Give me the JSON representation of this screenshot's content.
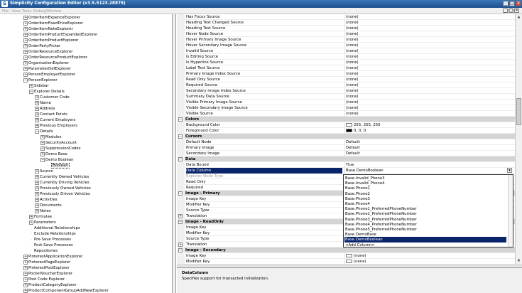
{
  "window": {
    "title": "Simplicity Configuration Editor (v3.5.5123.28879)",
    "icon_glyph": "S",
    "controls": {
      "minimize": "_",
      "maximize": "□",
      "close": "✕"
    }
  },
  "menu": {
    "items": [
      "File",
      "View",
      "Tools",
      "Debug",
      "Window"
    ],
    "mdi_controls": {
      "minimize": "_",
      "restore": "□",
      "close": "✕"
    }
  },
  "tree": {
    "rows": [
      {
        "label": "OrderItemExpenceExplorer",
        "depth": 3,
        "glyph": "+"
      },
      {
        "label": "OrderItemFixedPriceExplorer",
        "depth": 3,
        "glyph": "+"
      },
      {
        "label": "OrderItemNoteExplorer",
        "depth": 3,
        "glyph": "+"
      },
      {
        "label": "OrderItemProductExpandedExplorer",
        "depth": 3,
        "glyph": "+"
      },
      {
        "label": "OrderItemProductExplorer",
        "depth": 3,
        "glyph": "+"
      },
      {
        "label": "OrderPartyPicker",
        "depth": 3,
        "glyph": "+"
      },
      {
        "label": "OrderResourceExplorer",
        "depth": 3,
        "glyph": "+"
      },
      {
        "label": "OrderResourceProductExplorer",
        "depth": 3,
        "glyph": "+"
      },
      {
        "label": "OrganisationExplorer",
        "depth": 3,
        "glyph": "+"
      },
      {
        "label": "ParameterDefExplorer",
        "depth": 3,
        "glyph": "+"
      },
      {
        "label": "PersonEmployerExplorer",
        "depth": 3,
        "glyph": "+"
      },
      {
        "label": "PersonExplorer",
        "depth": 3,
        "glyph": "−"
      },
      {
        "label": "Sidebar",
        "depth": 4,
        "glyph": "+"
      },
      {
        "label": "Explorer Details",
        "depth": 4,
        "glyph": "−"
      },
      {
        "label": "Customer Code",
        "depth": 5,
        "glyph": "+"
      },
      {
        "label": "Name",
        "depth": 5,
        "glyph": "+"
      },
      {
        "label": "Address",
        "depth": 5,
        "glyph": "+"
      },
      {
        "label": "Contact Points",
        "depth": 5,
        "glyph": "+"
      },
      {
        "label": "Current Employers",
        "depth": 5,
        "glyph": "+"
      },
      {
        "label": "Previous Employers",
        "depth": 5,
        "glyph": "+"
      },
      {
        "label": "Details",
        "depth": 5,
        "glyph": "−"
      },
      {
        "label": "Modules",
        "depth": 6,
        "glyph": "+"
      },
      {
        "label": "SecurityAccount",
        "depth": 6,
        "glyph": "+"
      },
      {
        "label": "SuppressionCodes",
        "depth": 6,
        "glyph": "+"
      },
      {
        "label": "Demo Base",
        "depth": 6,
        "glyph": "+"
      },
      {
        "label": "Demo Boolean",
        "depth": 6,
        "glyph": "−"
      },
      {
        "label": "Boolean",
        "depth": 7,
        "glyph": "",
        "selected": true
      },
      {
        "label": "Source",
        "depth": 5,
        "glyph": "+"
      },
      {
        "label": "Currently Owned Vehicles",
        "depth": 5,
        "glyph": "+"
      },
      {
        "label": "Currently Driving Vehicles",
        "depth": 5,
        "glyph": "+"
      },
      {
        "label": "Previously Owned Vehicles",
        "depth": 5,
        "glyph": "+"
      },
      {
        "label": "Previously Driven Vehicles",
        "depth": 5,
        "glyph": "+"
      },
      {
        "label": "Activities",
        "depth": 5,
        "glyph": "+"
      },
      {
        "label": "Documents",
        "depth": 5,
        "glyph": "+"
      },
      {
        "label": "Notes",
        "depth": 5,
        "glyph": "+"
      },
      {
        "label": "Formulae",
        "depth": 4,
        "glyph": "+"
      },
      {
        "label": "Parameters",
        "depth": 4,
        "glyph": "+"
      },
      {
        "label": "Additional Relationships",
        "depth": 4,
        "glyph": ""
      },
      {
        "label": "Exclude Relationships",
        "depth": 4,
        "glyph": ""
      },
      {
        "label": "Pre-Save Processes",
        "depth": 4,
        "glyph": ""
      },
      {
        "label": "Post-Save Processes",
        "depth": 4,
        "glyph": ""
      },
      {
        "label": "Repositories",
        "depth": 4,
        "glyph": ""
      },
      {
        "label": "PinterestApplicationExplorer",
        "depth": 3,
        "glyph": "+"
      },
      {
        "label": "PinterestPageExplorer",
        "depth": 3,
        "glyph": "+"
      },
      {
        "label": "PinterestPostExplorer",
        "depth": 3,
        "glyph": "+"
      },
      {
        "label": "PocketVoucherExplorer",
        "depth": 3,
        "glyph": "+"
      },
      {
        "label": "Post Code Explorer",
        "depth": 3,
        "glyph": "+"
      },
      {
        "label": "ProductCategoryExplorer",
        "depth": 3,
        "glyph": "+"
      },
      {
        "label": "ProductComponentGroupAddNewExplorer",
        "depth": 3,
        "glyph": "+"
      }
    ]
  },
  "grid": {
    "rows": [
      {
        "type": "prop",
        "name": "Has Focus Source",
        "value": "(none)"
      },
      {
        "type": "prop",
        "name": "Heading Text Changed Source",
        "value": "(none)"
      },
      {
        "type": "prop",
        "name": "Heading Text Source",
        "value": "(none)"
      },
      {
        "type": "prop",
        "name": "Hover Node Source",
        "value": "(none)"
      },
      {
        "type": "prop",
        "name": "Hover Primary Image Source",
        "value": "(none)"
      },
      {
        "type": "prop",
        "name": "Hover Secondary Image Source",
        "value": "(none)"
      },
      {
        "type": "prop",
        "name": "Invalid Source",
        "value": "(none)"
      },
      {
        "type": "prop",
        "name": "Is Editing Source",
        "value": "(none)"
      },
      {
        "type": "prop",
        "name": "Is Hyperlink Source",
        "value": "(none)"
      },
      {
        "type": "prop",
        "name": "Label Text Source",
        "value": "(none)"
      },
      {
        "type": "prop",
        "name": "Primary Image Index Source",
        "value": "(none)"
      },
      {
        "type": "prop",
        "name": "Read Only Source",
        "value": "(none)"
      },
      {
        "type": "prop",
        "name": "Required Source",
        "value": "(none)"
      },
      {
        "type": "prop",
        "name": "Secondary Image Index Source",
        "value": "(none)"
      },
      {
        "type": "prop",
        "name": "Summary Data Source",
        "value": "(none)"
      },
      {
        "type": "prop",
        "name": "Visible Primary Image Source",
        "value": "(none)"
      },
      {
        "type": "prop",
        "name": "Visible Secondary Image Source",
        "value": "(none)"
      },
      {
        "type": "prop",
        "name": "Visible Source",
        "value": "(none)"
      },
      {
        "type": "cat",
        "name": "Colors",
        "glyph": "−"
      },
      {
        "type": "prop",
        "name": "Background Color",
        "value": "255, 255, 255",
        "swatch": "#ffffff"
      },
      {
        "type": "prop",
        "name": "Foreground Color",
        "value": "0, 0, 0",
        "swatch": "#000000"
      },
      {
        "type": "cat",
        "name": "Cursors",
        "glyph": "−"
      },
      {
        "type": "prop",
        "name": "Default Node",
        "value": "Default"
      },
      {
        "type": "prop",
        "name": "Primary Image",
        "value": "Default"
      },
      {
        "type": "prop",
        "name": "Secondary Image",
        "value": "Default"
      },
      {
        "type": "cat",
        "name": "Data",
        "glyph": "−"
      },
      {
        "type": "prop",
        "name": "Data Bound",
        "value": "True"
      },
      {
        "type": "prop",
        "name": "Data Column",
        "value": "Base.DemoBoolean",
        "selected": true
      },
      {
        "type": "prop",
        "name": "Explorer Node Type",
        "value": "",
        "disabled": true
      },
      {
        "type": "prop",
        "name": "Read Only",
        "value": ""
      },
      {
        "type": "prop",
        "name": "Required",
        "value": ""
      },
      {
        "type": "cat",
        "name": "Image - Primary",
        "glyph": "−"
      },
      {
        "type": "prop",
        "name": "Image Key",
        "value": ""
      },
      {
        "type": "prop",
        "name": "Modifier Key",
        "value": ""
      },
      {
        "type": "prop",
        "name": "Source Type",
        "value": ""
      },
      {
        "type": "prop",
        "name": "Translation",
        "value": "",
        "glyph": "+"
      },
      {
        "type": "cat",
        "name": "Image - ReadOnly",
        "glyph": "−"
      },
      {
        "type": "prop",
        "name": "Image Key",
        "value": ""
      },
      {
        "type": "prop",
        "name": "Modifier Key",
        "value": ""
      },
      {
        "type": "prop",
        "name": "Source Type",
        "value": ""
      },
      {
        "type": "prop",
        "name": "Translation",
        "value": "",
        "glyph": "+"
      },
      {
        "type": "cat",
        "name": "Image - Secondary",
        "glyph": "−"
      },
      {
        "type": "prop",
        "name": "Image Key",
        "value": "(none)",
        "swatch": "#ffffff"
      },
      {
        "type": "prop",
        "name": "Modifier Key",
        "value": "(none)",
        "swatch": "#ffffff"
      }
    ]
  },
  "dropdown": {
    "items": [
      {
        "label": "Base.Invalid_Phone3"
      },
      {
        "label": "Base.Invalid_Phone4"
      },
      {
        "label": "Base.Phone1"
      },
      {
        "label": "Base.Phone2"
      },
      {
        "label": "Base.Phone3"
      },
      {
        "label": "Base.Phone4"
      },
      {
        "label": "Base.Phone1_PreferredPhoneNumber"
      },
      {
        "label": "Base.Phone2_PreferredPhoneNumber"
      },
      {
        "label": "Base.Phone3_PreferredPhoneNumber"
      },
      {
        "label": "Base.Phone4_PreferredPhoneNumber"
      },
      {
        "label": "Base.Phone5_PreferredPhoneNumber"
      },
      {
        "label": "Base.DemoBase"
      },
      {
        "label": "Base.DemoBoolean",
        "selected": true
      },
      {
        "label": "<Add Column>"
      }
    ]
  },
  "help": {
    "title": "DataColumn",
    "description": "Specifies support for transacted initialization."
  }
}
